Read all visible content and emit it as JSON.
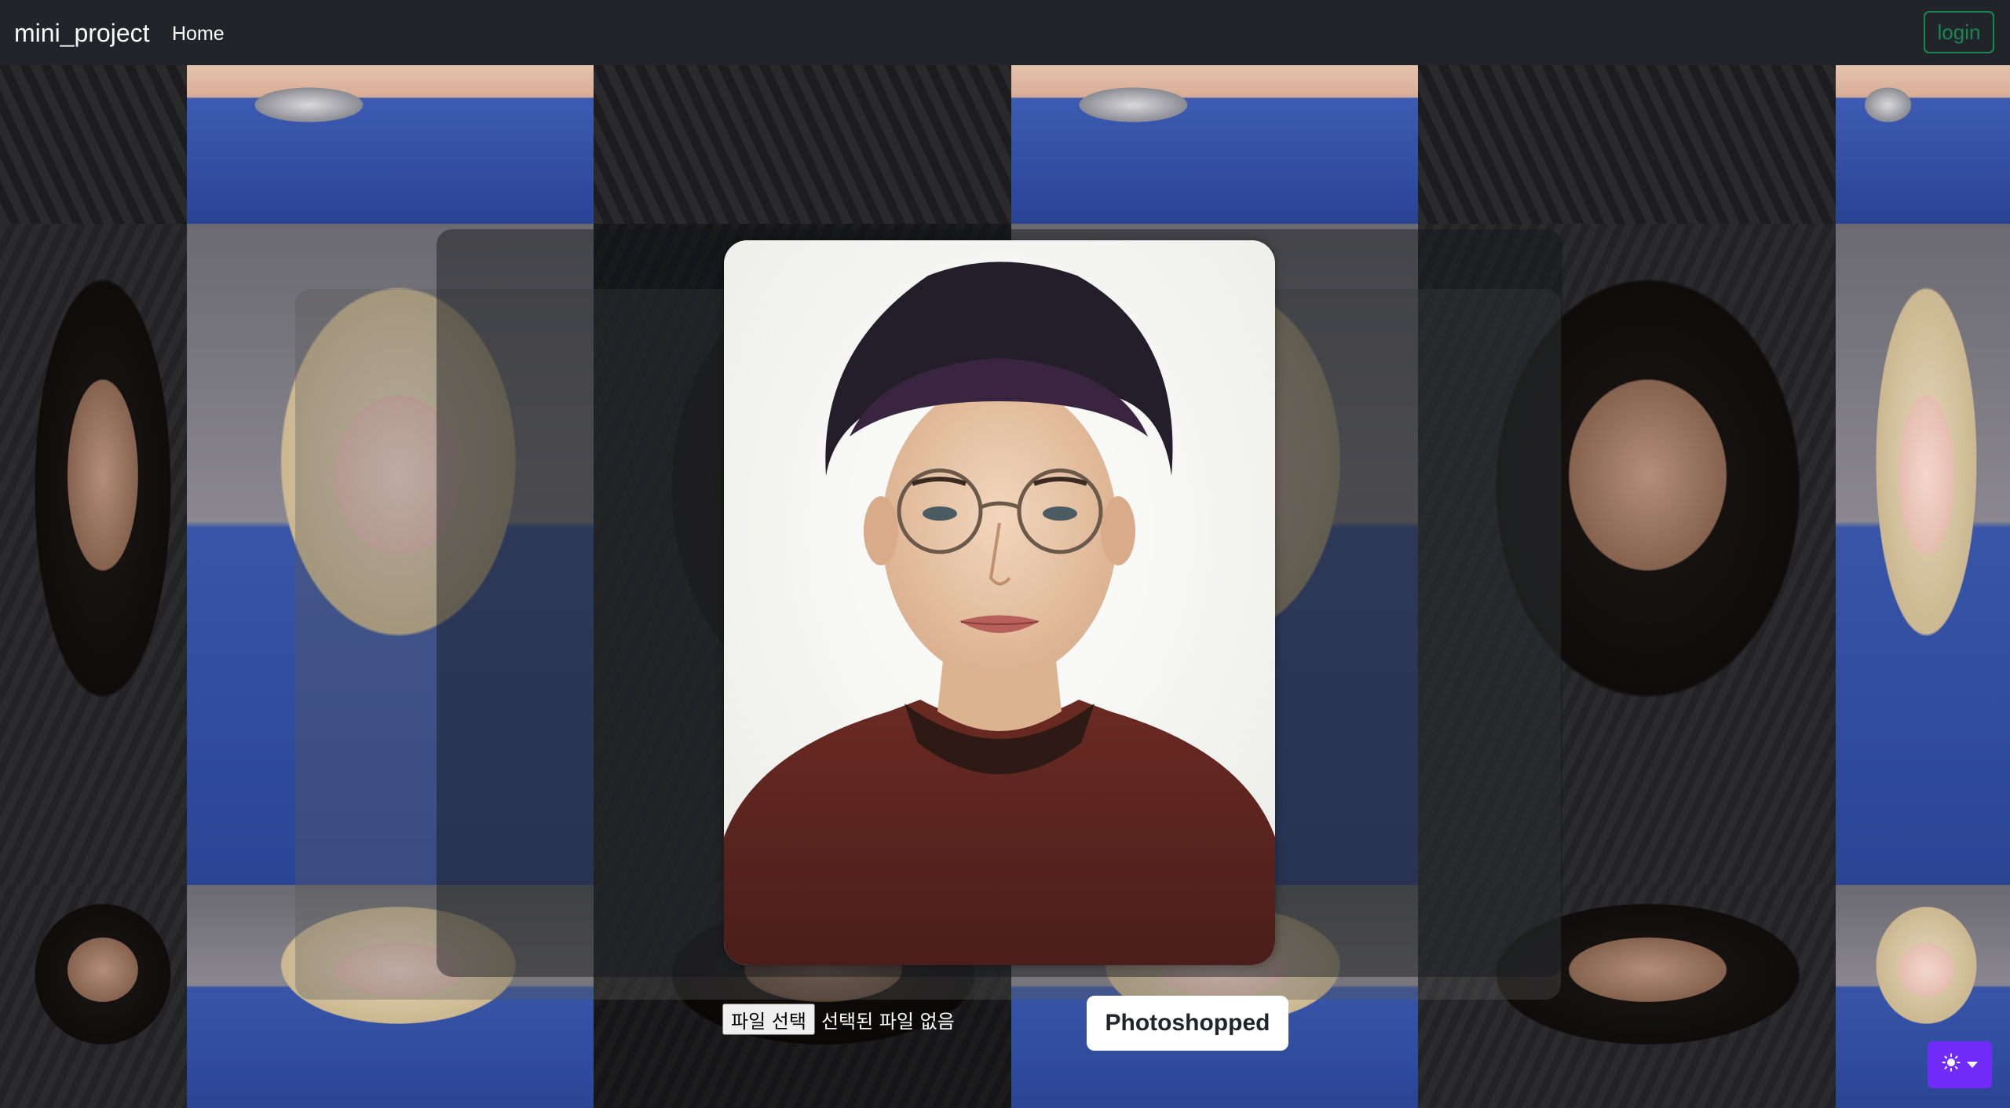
{
  "navbar": {
    "brand": "mini_project",
    "home_link": "Home",
    "login_label": "login"
  },
  "upload": {
    "choose_file_label": "파일 선택",
    "file_status": "선택된 파일 없음"
  },
  "actions": {
    "photoshop_label": "Photoshopped"
  },
  "theme_toggle": {
    "icon": "sun-icon"
  },
  "colors": {
    "navbar_bg": "#212529",
    "login_accent": "#198754",
    "theme_button": "#712cf9"
  }
}
